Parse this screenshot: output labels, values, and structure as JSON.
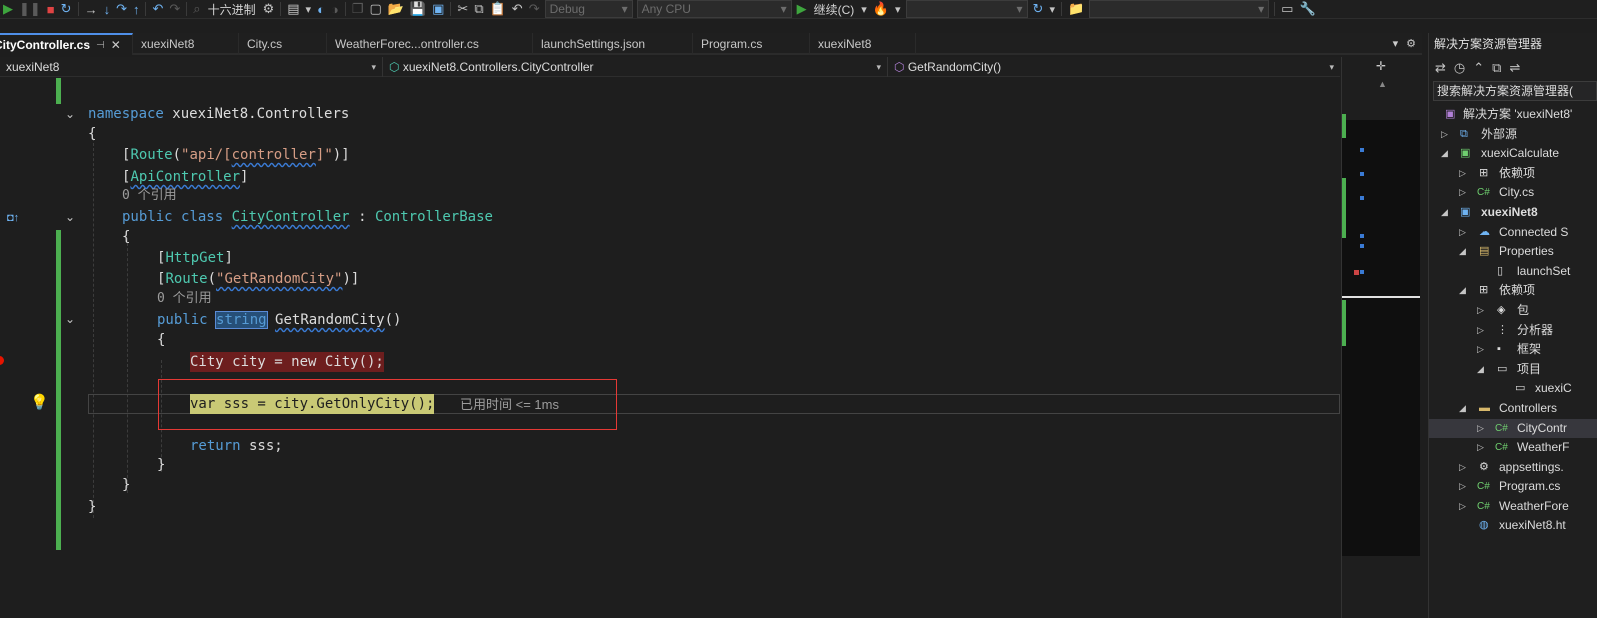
{
  "toolbar": {
    "hex_label": "十六进制",
    "config": "Debug",
    "platform": "Any CPU",
    "continue_label": "继续(C)",
    "icons": [
      "continue-icon",
      "pause-icon",
      "stop-icon",
      "restart-icon",
      "step-into-icon",
      "step-over-icon",
      "step-out-icon",
      "undo-icon",
      "redo-icon",
      "save-icon",
      "save-all-icon",
      "cut-icon",
      "copy-icon",
      "paste-icon",
      "hot-reload-icon",
      "settings-icon"
    ]
  },
  "tabs": [
    {
      "label": "CityController.cs",
      "active": true
    },
    {
      "label": "xuexiNet8"
    },
    {
      "label": "City.cs"
    },
    {
      "label": "WeatherForec...ontroller.cs"
    },
    {
      "label": "launchSettings.json"
    },
    {
      "label": "Program.cs"
    },
    {
      "label": "xuexiNet8"
    }
  ],
  "navbar": {
    "project": "xuexiNet8",
    "class": "xuexiNet8.Controllers.CityController",
    "member": "GetRandomCity()"
  },
  "code": {
    "line_namespace_kw": "namespace",
    "line_namespace_name": "xuexiNet8.Controllers",
    "brace_open": "{",
    "brace_close": "}",
    "route_attr": "Route",
    "route_arg": "\"api/[controller]\"",
    "route_controller_part": "controller",
    "apicontroller": "ApiController",
    "refs_zero": "0 个引用",
    "class_decl": [
      "public",
      "class",
      "CityController",
      ":",
      "ControllerBase"
    ],
    "httpget": "HttpGet",
    "route_method_arg": "\"GetRandomCity\"",
    "method_decl": [
      "public",
      "string",
      "GetRandomCity",
      "()"
    ],
    "line_city": "City city = new City();",
    "line_var": "var sss = city.GetOnlyCity();",
    "elapsed": "已用时间 <= 1ms",
    "line_return": "return sss;"
  },
  "solution_explorer": {
    "title": "解决方案资源管理器",
    "search_placeholder": "搜索解决方案资源管理器(",
    "items": [
      {
        "label": "解决方案 'xuexiNet8'"
      },
      {
        "label": "外部源"
      },
      {
        "label": "xuexiCalculate"
      },
      {
        "label": "依赖项"
      },
      {
        "label": "City.cs"
      },
      {
        "label": "xuexiNet8"
      },
      {
        "label": "Connected S"
      },
      {
        "label": "Properties"
      },
      {
        "label": "launchSet"
      },
      {
        "label": "依赖项"
      },
      {
        "label": "包"
      },
      {
        "label": "分析器"
      },
      {
        "label": "框架"
      },
      {
        "label": "项目"
      },
      {
        "label": "xuexiC"
      },
      {
        "label": "Controllers"
      },
      {
        "label": "CityContr"
      },
      {
        "label": "WeatherF"
      },
      {
        "label": "appsettings."
      },
      {
        "label": "Program.cs"
      },
      {
        "label": "WeatherFore"
      },
      {
        "label": "xuexiNet8.ht"
      }
    ]
  }
}
